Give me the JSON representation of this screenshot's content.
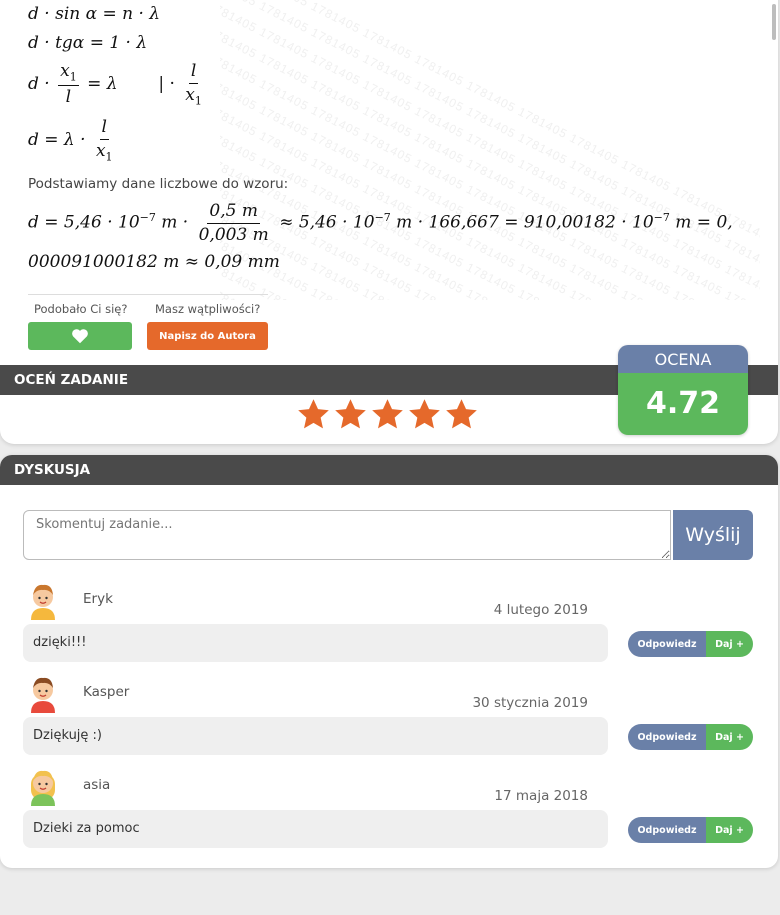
{
  "watermark": "1781405",
  "solution": {
    "eq1": "d · sin α = n · λ",
    "eq2": "d · tgα = 1 · λ",
    "eq3_frac_num": "x",
    "eq3_frac_num_sub": "1",
    "eq3_frac_den": "l",
    "eq3_rhs": "= λ",
    "eq3_bar": "|  ·",
    "eq3_mult_num": "l",
    "eq3_mult_den": "x",
    "eq3_mult_den_sub": "1",
    "eq4_lhs": "d = λ ·",
    "eq4_num": "l",
    "eq4_den": "x",
    "eq4_den_sub": "1",
    "subst_label": "Podstawiamy dane liczbowe do wzoru:",
    "calc_a": "d = 5,46 · 10",
    "calc_exp": "−7",
    "calc_unit_m": " m ·",
    "calc_frac_num": "0,5 m",
    "calc_frac_den": "0,003 m",
    "calc_b": "≈ 5,46 · 10",
    "calc_c": " m · 166,667 = 910,00182 · 10",
    "calc_d": " m = 0,",
    "calc_line2": "000091000182 m ≈ 0,09 mm"
  },
  "feedback": {
    "like_label": "Podobało Ci się?",
    "doubt_label": "Masz wątpliwości?",
    "author_button": "Napisz do Autora"
  },
  "rating": {
    "bar_title": "OCEŃ ZADANIE",
    "head": "OCENA",
    "value": "4.72",
    "stars": 5,
    "star_color": "#e5692b"
  },
  "discussion": {
    "title": "DYSKUSJA",
    "placeholder": "Skomentuj zadanie...",
    "send_label": "Wyślij",
    "reply_label": "Odpowiedz",
    "plus_label": "Daj +",
    "comments": [
      {
        "name": "Eryk",
        "date": "4 lutego 2019",
        "text": "dzięki!!!",
        "avatar": "boy-curly-avatar"
      },
      {
        "name": "Kasper",
        "date": "30 stycznia 2019",
        "text": "Dziękuję :)",
        "avatar": "boy-avatar"
      },
      {
        "name": "asia",
        "date": "17 maja 2018",
        "text": "Dzieki za pomoc",
        "avatar": "girl-avatar"
      }
    ]
  }
}
